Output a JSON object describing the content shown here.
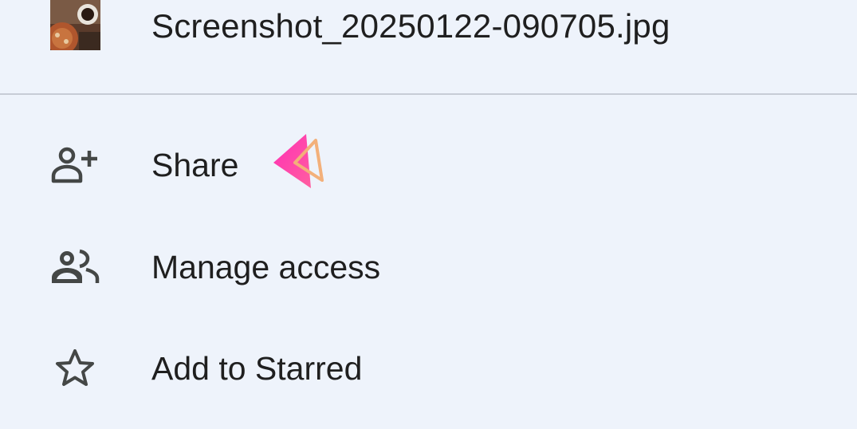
{
  "file": {
    "name": "Screenshot_20250122-090705.jpg",
    "thumbnail_icon": "image-thumbnail"
  },
  "menu": {
    "items": [
      {
        "label": "Share",
        "icon": "person-add-icon"
      },
      {
        "label": "Manage access",
        "icon": "people-icon"
      },
      {
        "label": "Add to Starred",
        "icon": "star-outline-icon"
      }
    ]
  },
  "colors": {
    "background": "#eef3fb",
    "text": "#1f1f1f",
    "icon": "#444746",
    "divider": "#c7ccd6",
    "cursor_pink": "#ff3fa8",
    "cursor_orange": "#f3a66b"
  }
}
